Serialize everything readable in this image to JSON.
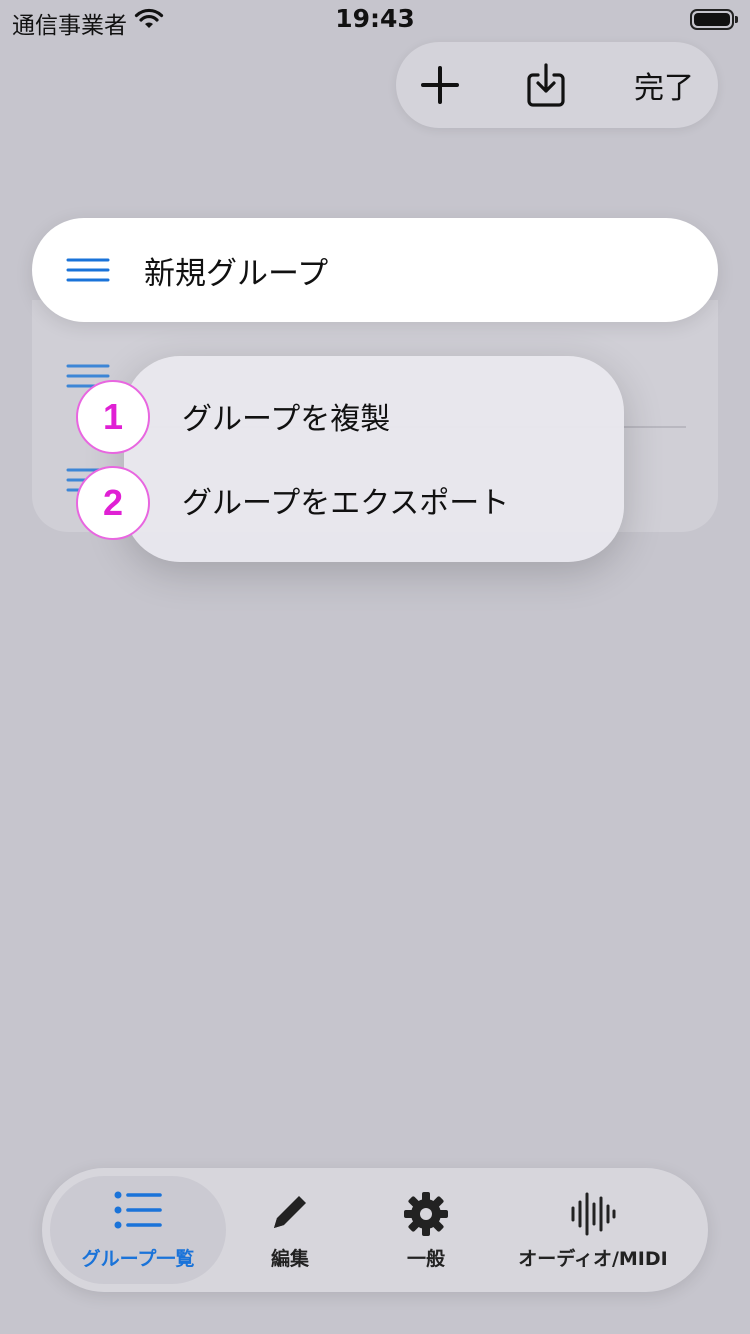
{
  "status_bar": {
    "carrier": "通信事業者",
    "time": "19:43"
  },
  "toolbar": {
    "add_icon": "plus-icon",
    "import_icon": "tray-arrow-down-icon",
    "done_label": "完了"
  },
  "highlighted_item": {
    "label": "新規グループ",
    "icon": "hamburger-menu-icon"
  },
  "context_menu": {
    "items": [
      {
        "label": "グループを複製",
        "badge": "1"
      },
      {
        "label": "グループをエクスポート",
        "badge": "2"
      }
    ]
  },
  "tab_bar": {
    "tabs": [
      {
        "label": "グループ一覧",
        "icon": "list-bullet-icon",
        "active": true
      },
      {
        "label": "編集",
        "icon": "pencil-icon",
        "active": false
      },
      {
        "label": "一般",
        "icon": "gear-icon",
        "active": false
      },
      {
        "label": "オーディオ/MIDI",
        "icon": "waveform-icon",
        "active": false
      }
    ]
  },
  "colors": {
    "accent": "#1a73d9",
    "badge": "#e020d4",
    "background": "#c6c5cd"
  }
}
